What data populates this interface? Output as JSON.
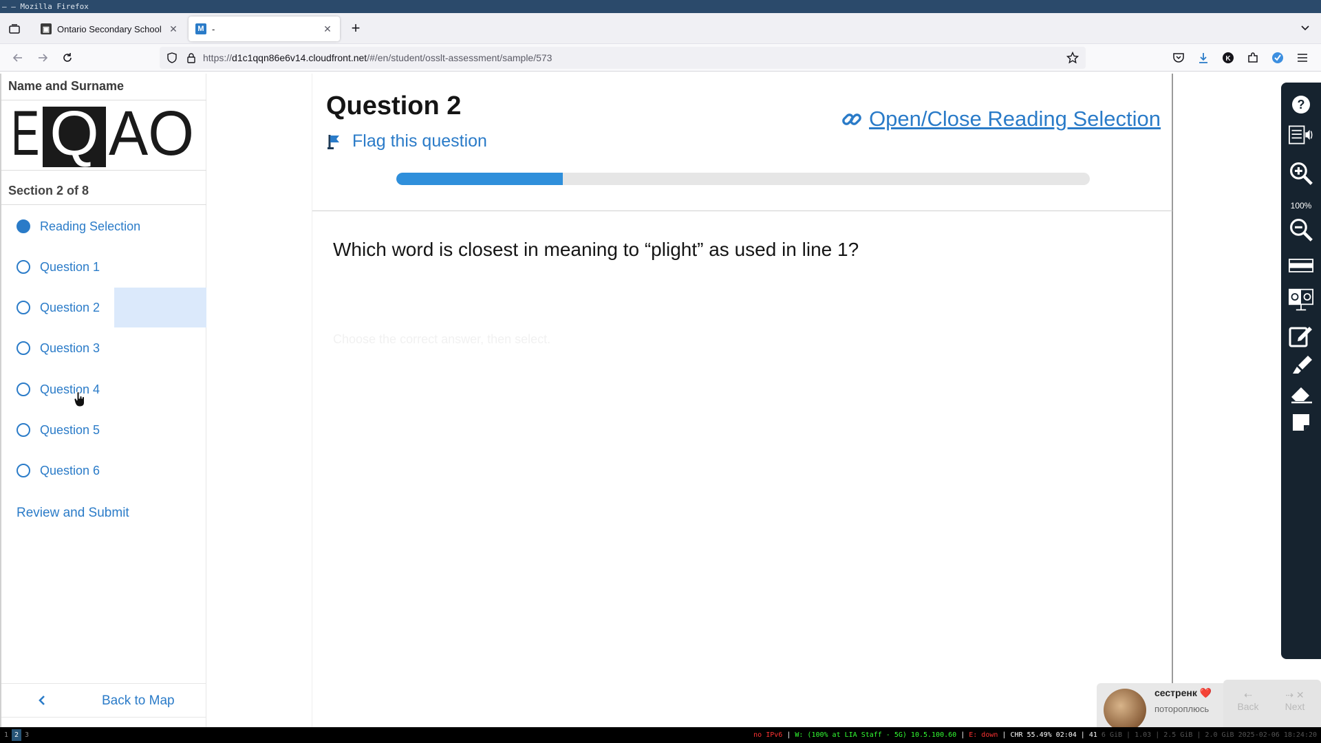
{
  "window": {
    "title": "– – Mozilla Firefox"
  },
  "tabs": [
    {
      "title": "Ontario Secondary School",
      "active": false,
      "favicon": "osslt-favicon"
    },
    {
      "title": "-",
      "active": true,
      "favicon": "m-favicon",
      "favicon_letter": "M"
    }
  ],
  "url": {
    "prefix": "https://",
    "host": "d1c1qqn86e6v14.cloudfront.net",
    "path": "/#/en/student/osslt-assessment/sample/573"
  },
  "sidebar": {
    "student_name": "Name and Surname",
    "logo_text": "EQAO",
    "section": "Section 2 of 8",
    "items": [
      {
        "label": "Reading Selection",
        "state": "filled"
      },
      {
        "label": "Question 1",
        "state": "empty"
      },
      {
        "label": "Question 2",
        "state": "empty",
        "current": true
      },
      {
        "label": "Question 3",
        "state": "empty"
      },
      {
        "label": "Question 4",
        "state": "empty"
      },
      {
        "label": "Question 5",
        "state": "empty"
      },
      {
        "label": "Question 6",
        "state": "empty"
      }
    ],
    "review_label": "Review and Submit",
    "back_label": "Back to Map"
  },
  "main": {
    "question_title": "Question 2",
    "flag_label": "Flag this question",
    "reading_toggle_label": "Open/Close Reading Selection",
    "progress_fraction": 0.24,
    "question_text": "Which word is closest in meaning to “plight” as used in line 1?",
    "faded_hint": "Choose the correct answer, then select."
  },
  "toolbar": {
    "zoom_level": "100%",
    "icons": [
      "help-icon",
      "text-to-speech-icon",
      "zoom-in-icon",
      "zoom-out-icon",
      "line-reader-icon",
      "contrast-icon",
      "notepad-icon",
      "highlighter-icon",
      "eraser-icon",
      "sticky-note-icon"
    ]
  },
  "notification": {
    "title": "сестренк ❤️",
    "subtitle": "потороплюсь"
  },
  "pager": {
    "back_label": "Back",
    "next_label": "Next"
  },
  "statusbar": {
    "workspaces": [
      "1",
      "2",
      "3"
    ],
    "active_workspace": "2",
    "ipv6": "no IPv6",
    "wifi": "W: (100% at LIA Staff - 5G) 10.5.100.60",
    "ethernet": "E: down",
    "battery": "CHR 55.49% 02:04",
    "load": "41",
    "mem": "6 GiB | 1.03 | 2.5 GiB | 2.0 GiB",
    "datetime": "2025-02-06 18:24:20"
  },
  "colors": {
    "accent": "#2a7bc8",
    "progress": "#2f8fdb",
    "toolbar_bg": "#16232f",
    "hover_bg": "#dbe9fb"
  }
}
